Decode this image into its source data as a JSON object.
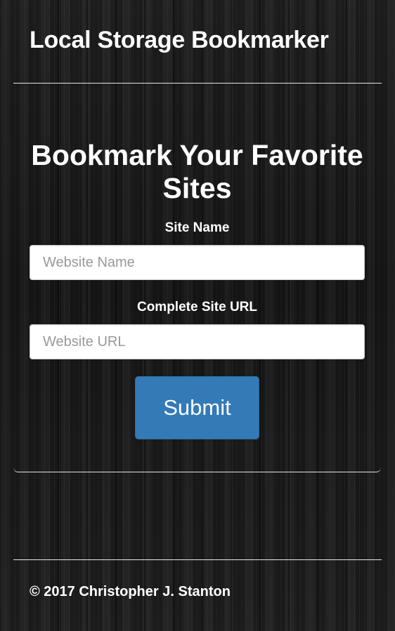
{
  "header": {
    "title": "Local Storage Bookmarker"
  },
  "main": {
    "heading": "Bookmark Your Favorite Sites",
    "site_name": {
      "label": "Site Name",
      "placeholder": "Website Name",
      "value": ""
    },
    "site_url": {
      "label": "Complete Site URL",
      "placeholder": "Website URL",
      "value": ""
    },
    "submit_label": "Submit"
  },
  "footer": {
    "copyright": "© 2017 Christopher J. Stanton"
  },
  "colors": {
    "background": "#1a1a1a",
    "text": "#ffffff",
    "button": "#337ab7",
    "divider": "#e6e6e6"
  }
}
